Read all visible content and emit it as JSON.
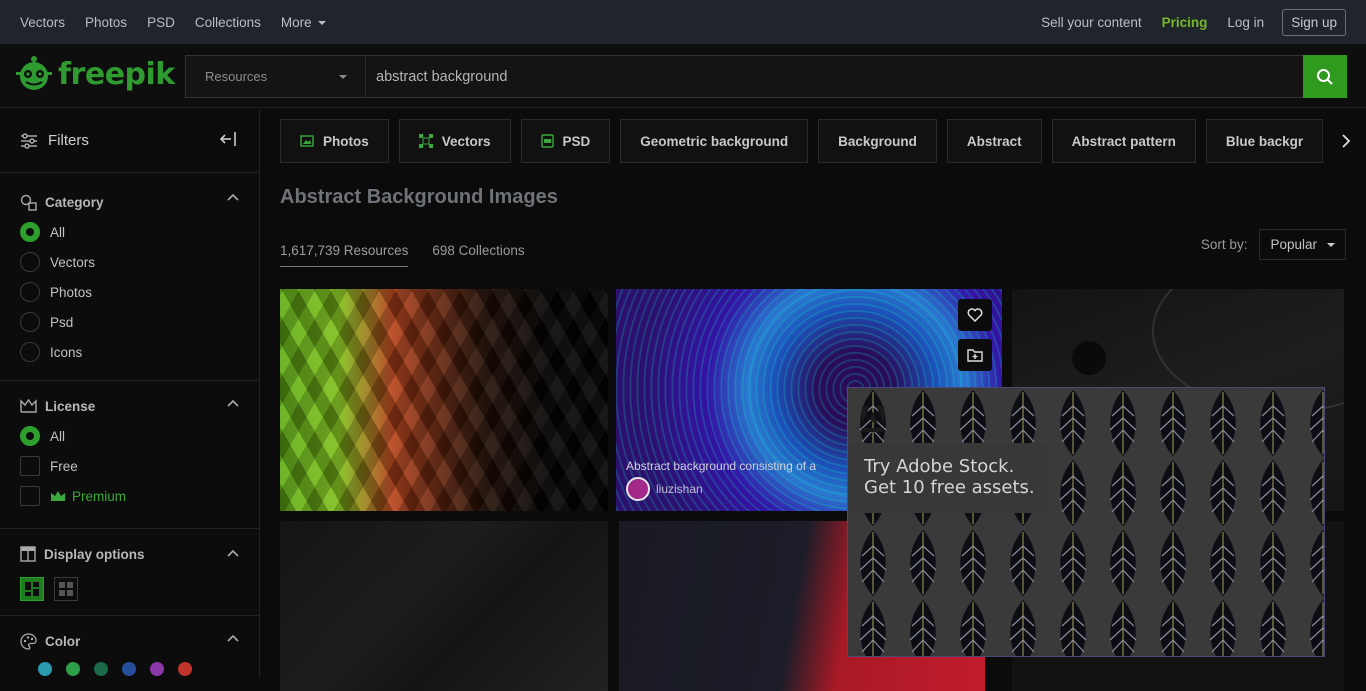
{
  "topnav": {
    "links": [
      "Vectors",
      "Photos",
      "PSD",
      "Collections",
      "More"
    ],
    "sell": "Sell your content",
    "pricing": "Pricing",
    "login": "Log in",
    "signup": "Sign up"
  },
  "header": {
    "logo": "freepik",
    "search_category": "Resources",
    "search_value": "abstract background"
  },
  "sidebar": {
    "filters": "Filters",
    "category": {
      "title": "Category",
      "options": [
        "All",
        "Vectors",
        "Photos",
        "Psd",
        "Icons"
      ]
    },
    "license": {
      "title": "License",
      "options": [
        "All",
        "Free",
        "Premium"
      ]
    },
    "display": {
      "title": "Display options"
    },
    "color": {
      "title": "Color",
      "swatches": [
        "#2a9bb0",
        "#2f9f4a",
        "#1c6a4a",
        "#254d9a",
        "#8a3aa8",
        "#c0352b"
      ]
    }
  },
  "chips": [
    "Photos",
    "Vectors",
    "PSD",
    "Geometric background",
    "Background",
    "Abstract",
    "Abstract pattern",
    "Blue backgr"
  ],
  "page_title": "Abstract Background Images",
  "tabs": {
    "resources": "1,617,739 Resources",
    "collections": "698 Collections"
  },
  "sort": {
    "label": "Sort by:",
    "value": "Popular"
  },
  "tiles": {
    "caption": "Abstract background consisting of a",
    "author": "liuzishan"
  },
  "ad": {
    "brand": "Adobe",
    "line1": "Try Adobe Stock.",
    "line2": "Get 10 free assets."
  },
  "colors": {
    "accent": "#2f9a1e",
    "pricing": "#76b82a",
    "topbar": "#1f252b"
  }
}
